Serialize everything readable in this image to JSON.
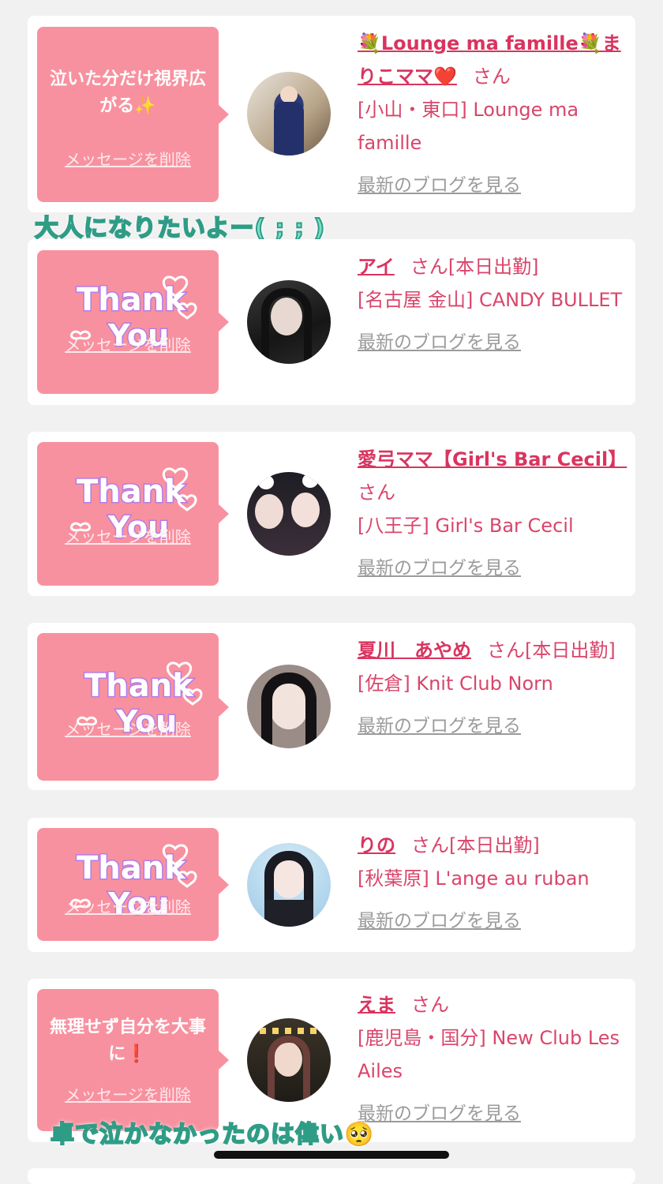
{
  "entries": [
    {
      "message": "泣いた分だけ視界広がる✨",
      "thanks": false,
      "delete_label": "メッセージを削除",
      "name": "💐Lounge ma famille💐まりこママ❤️",
      "san": "さん",
      "status": "",
      "shop": "[小山・東口] Lounge ma famille",
      "blog_label": "最新のブログを見る"
    },
    {
      "message": "",
      "thanks": true,
      "delete_label": "メッセージを削除",
      "name": "アイ",
      "san": "さん",
      "status": "[本日出勤]",
      "shop": "[名古屋 金山] CANDY BULLET",
      "blog_label": "最新のブログを見る"
    },
    {
      "message": "",
      "thanks": true,
      "delete_label": "メッセージを削除",
      "name": "愛弓ママ【Girl's Bar Cecil】",
      "san": "さん",
      "status": "",
      "shop": "[八王子] Girl's Bar Cecil",
      "blog_label": "最新のブログを見る"
    },
    {
      "message": "",
      "thanks": true,
      "delete_label": "メッセージを削除",
      "name": "夏川　あやめ",
      "san": "さん",
      "status": "[本日出勤]",
      "shop": "[佐倉] Knit Club Norn",
      "blog_label": "最新のブログを見る"
    },
    {
      "message": "",
      "thanks": true,
      "delete_label": "メッセージを削除",
      "name": "りの",
      "san": "さん",
      "status": "[本日出勤]",
      "shop": "[秋葉原] L'ange au ruban",
      "blog_label": "最新のブログを見る"
    },
    {
      "message": "無理せず自分を大事に❗️",
      "thanks": false,
      "delete_label": "メッセージを削除",
      "name": "えま",
      "san": "さん",
      "status": "",
      "shop": "[鹿児島・国分] New Club Les Ailes",
      "blog_label": "最新のブログを見る"
    }
  ],
  "thanks_art": {
    "line1": "Thank",
    "line2": "You"
  },
  "overlays": {
    "top": "大人になりたいよー( ; ; )",
    "bottom": "卓で泣かなかったのは偉い🥺"
  },
  "colors": {
    "bubble": "#f8919f",
    "name": "#d9345f",
    "link_gray": "#9b9b9b",
    "overlay_text": "#7be0c8"
  }
}
